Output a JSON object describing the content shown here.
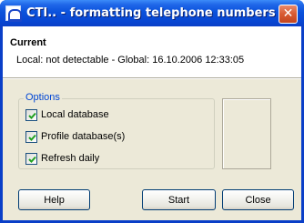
{
  "window": {
    "title": "CTI.. - formatting telephone numbers",
    "close_glyph": "✕"
  },
  "current": {
    "heading": "Current",
    "detail": "Local: not detectable - Global: 16.10.2006 12:33:05"
  },
  "options": {
    "label": "Options",
    "items": [
      {
        "label": "Local database",
        "checked": true
      },
      {
        "label": "Profile database(s)",
        "checked": true
      },
      {
        "label": "Refresh daily",
        "checked": true
      }
    ]
  },
  "buttons": {
    "help": "Help",
    "start": "Start",
    "close": "Close"
  },
  "colors": {
    "titlebar": "#0a52dc",
    "accent": "#0046d5",
    "checkmark": "#21a121",
    "dialog_bg": "#ece9d8"
  }
}
